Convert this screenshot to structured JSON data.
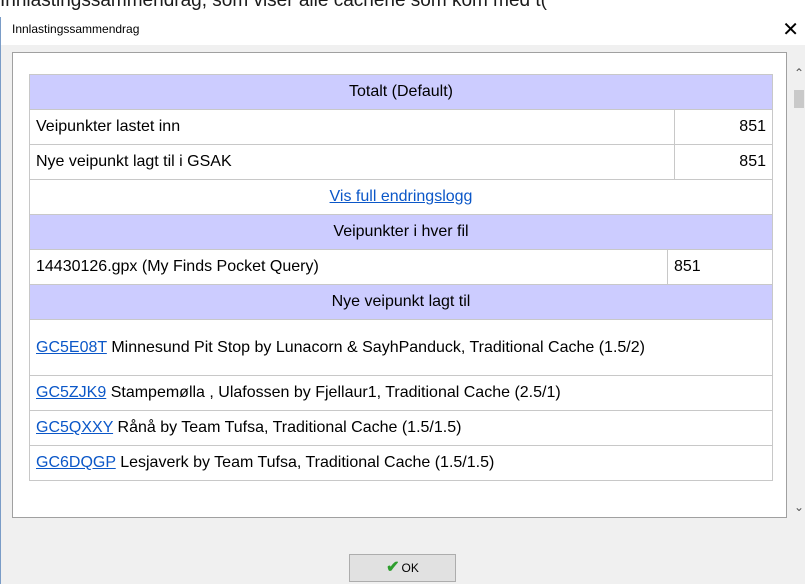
{
  "background_text": "Innlastingssammendrag, som viser alle cachene som kom med t(",
  "dialog": {
    "title": "Innlastingssammendrag",
    "close_symbol": "✕",
    "ok_label": "OK"
  },
  "summary": {
    "total_header": "Totalt (Default)",
    "rows": [
      {
        "label": "Veipunkter lastet inn",
        "value": "851"
      },
      {
        "label": "Nye veipunkt lagt til i GSAK",
        "value": "851"
      }
    ],
    "changelog_link": "Vis full endringslogg",
    "files_header": "Veipunkter i hver fil",
    "files": [
      {
        "name": "14430126.gpx (My Finds Pocket Query)",
        "count": "851"
      }
    ],
    "new_header": "Nye veipunkt lagt til",
    "new_waypoints": [
      {
        "code": "GC5E08T",
        "desc": "Minnesund Pit Stop by Lunacorn & SayhPanduck, Traditional Cache (1.5/2)"
      },
      {
        "code": "GC5ZJK9",
        "desc": "Stampemølla , Ulafossen by Fjellaur1, Traditional Cache (2.5/1)"
      },
      {
        "code": "GC5QXXY",
        "desc": "Rånå by Team Tufsa, Traditional Cache (1.5/1.5)"
      },
      {
        "code": "GC6DQGP",
        "desc": "Lesjaverk by Team Tufsa, Traditional Cache (1.5/1.5)"
      }
    ]
  },
  "icons": {
    "ok": "checkmark-icon",
    "scroll_up": "chevron-up-icon",
    "scroll_down": "chevron-down-icon"
  },
  "colors": {
    "header_bg": "#ccccff",
    "link": "#0b57c8"
  }
}
